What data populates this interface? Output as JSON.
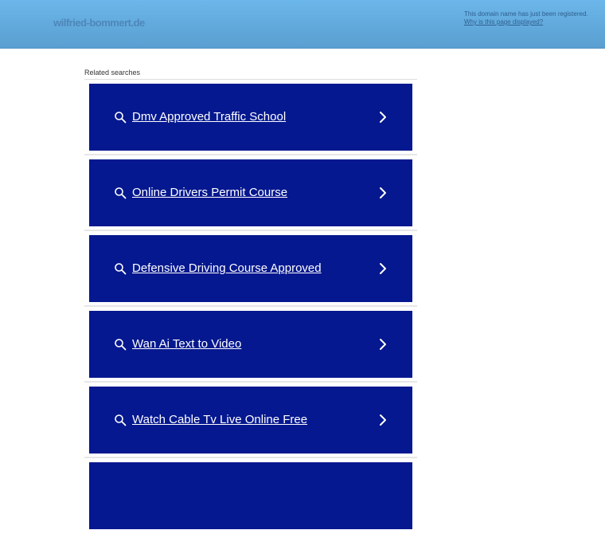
{
  "header": {
    "domain": "wilfried-bommert.de",
    "notice_text": "This domain name has just been registered.",
    "notice_link": "Why is this page displayed?"
  },
  "related": {
    "label": "Related searches",
    "items": [
      {
        "label": "Dmv Approved Traffic School",
        "icon": "search-icon",
        "arrow": "chevron-right-icon"
      },
      {
        "label": "Online Drivers Permit Course",
        "icon": "search-icon",
        "arrow": "chevron-right-icon"
      },
      {
        "label": "Defensive Driving Course Approved",
        "icon": "search-icon",
        "arrow": "chevron-right-icon"
      },
      {
        "label": "Wan Ai Text to Video",
        "icon": "search-icon",
        "arrow": "chevron-right-icon"
      },
      {
        "label": "Watch Cable Tv Live Online Free",
        "icon": "search-icon",
        "arrow": "chevron-right-icon"
      }
    ]
  },
  "colors": {
    "header_top": "#6bb6ea",
    "tile_bg": "#05188f",
    "tile_text": "#ffffff"
  }
}
